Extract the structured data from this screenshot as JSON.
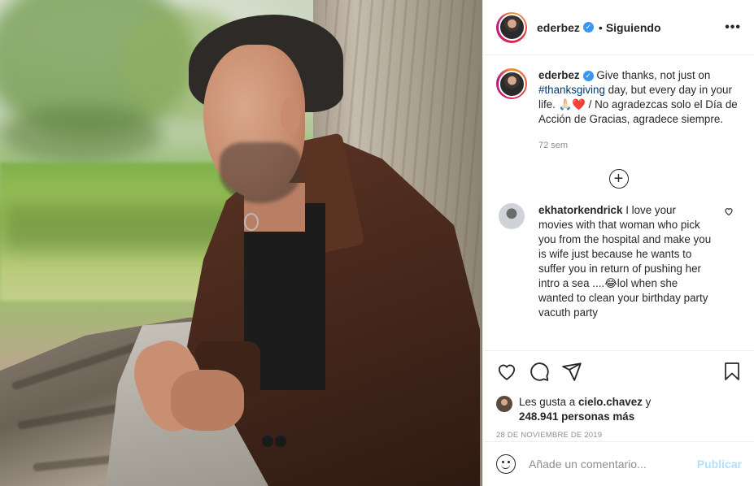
{
  "post": {
    "username": "ederbez",
    "verified": true,
    "follow_separator": "•",
    "follow_status": "Siguiendo",
    "more_label": "•••"
  },
  "caption": {
    "username": "ederbez",
    "text_before_hashtag": "Give thanks, not just on ",
    "hashtag": "#thanksgiving",
    "text_after_hashtag": " day, but every day in your life. 🙏🏻❤️ / No agradezcas solo el Día de Acción de Gracias, agradece siempre.",
    "time": "72 sem"
  },
  "load_more_label": "+",
  "comments": [
    {
      "username": "ekhatorkendrick",
      "text": "I love your movies with that woman who pick you from the hospital and make you is wife just because he wants to suffer you in return of pushing her intro a sea ....😂lol when she wanted to clean your birthday party vacuth party"
    }
  ],
  "likes": {
    "prefix": "Les gusta a ",
    "user": "cielo.chavez",
    "conj": " y",
    "count_text": "248.941 personas más"
  },
  "date": "28 DE NOVIEMBRE DE 2019",
  "add_comment": {
    "placeholder": "Añade un comentario...",
    "publish_label": "Publicar"
  },
  "icons": [
    "heart-icon",
    "comment-icon",
    "share-icon",
    "bookmark-icon",
    "emoji-icon",
    "verified-icon",
    "plus-circle-icon"
  ],
  "colors": {
    "link": "#00376b",
    "publish_disabled": "#b2dffc",
    "verified": "#3897f0",
    "muted": "#8e8e8e"
  }
}
